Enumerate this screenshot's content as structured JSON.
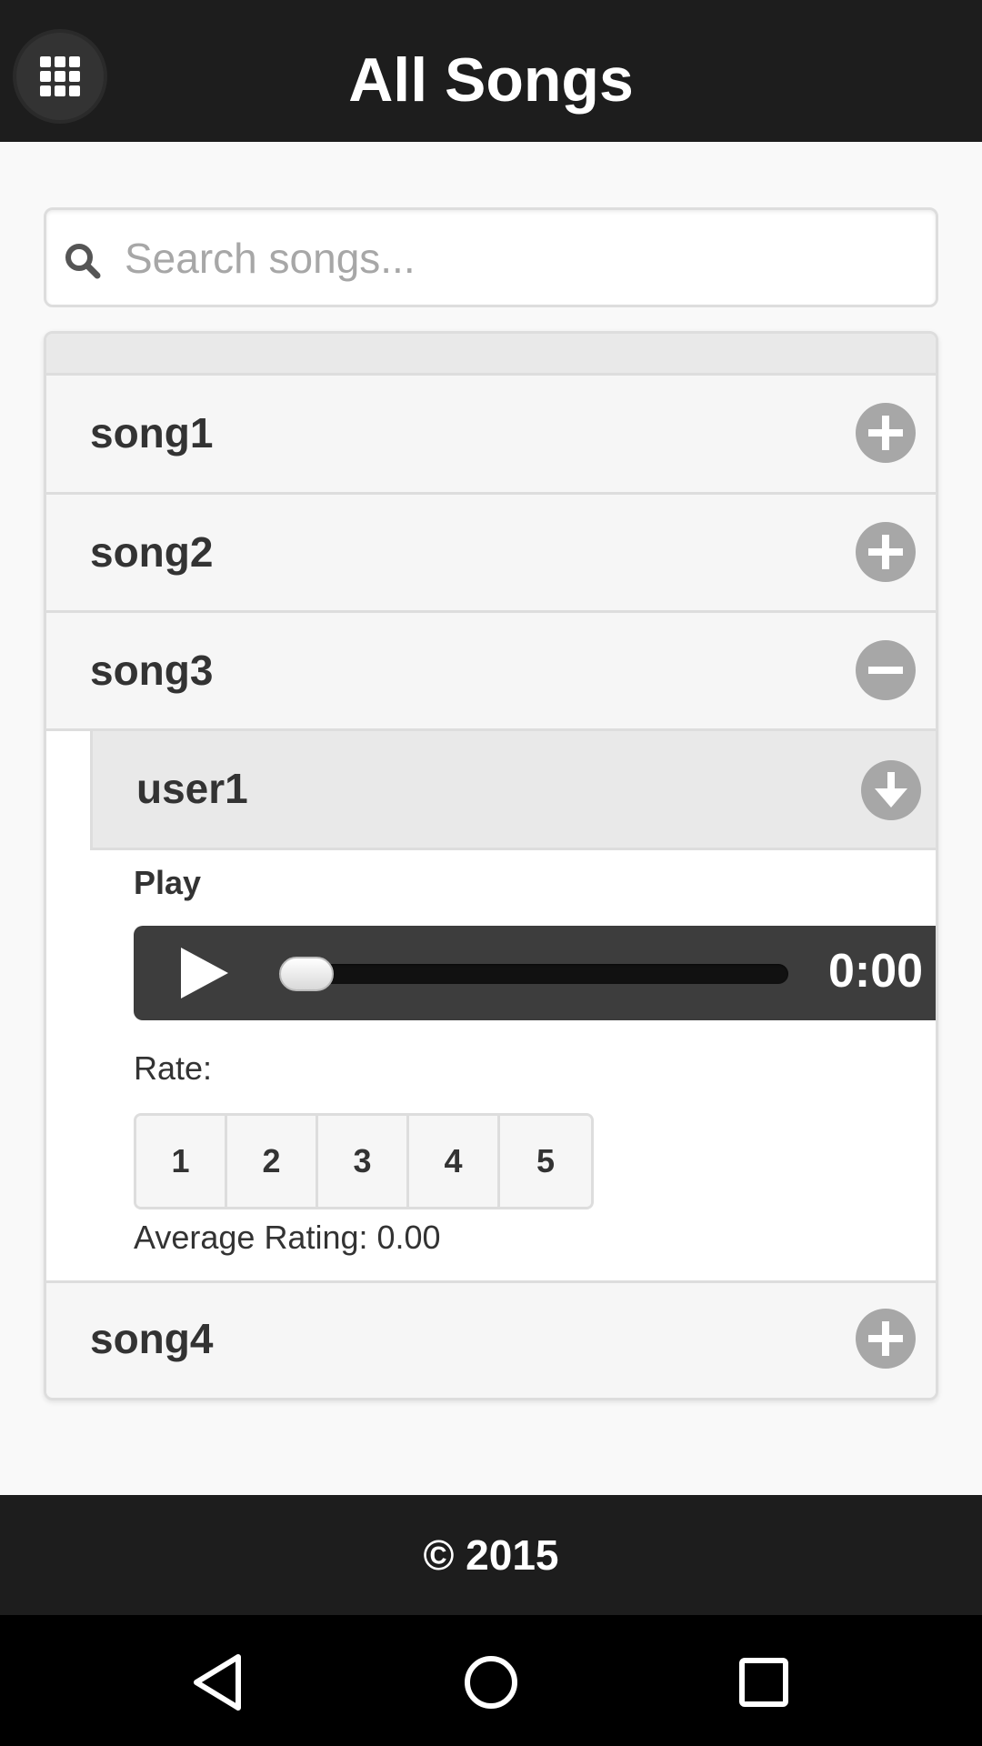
{
  "header": {
    "title": "All Songs",
    "menu_icon": "grid-menu-icon"
  },
  "search": {
    "placeholder": "Search songs...",
    "value": "",
    "icon": "search-icon"
  },
  "songs": [
    {
      "label": "song1",
      "state": "collapsed",
      "icon": "plus-circle-icon"
    },
    {
      "label": "song2",
      "state": "collapsed",
      "icon": "plus-circle-icon"
    },
    {
      "label": "song3",
      "state": "expanded",
      "icon": "minus-circle-icon"
    },
    {
      "label": "song4",
      "state": "collapsed",
      "icon": "plus-circle-icon"
    }
  ],
  "expanded": {
    "user": {
      "label": "user1",
      "icon": "arrow-down-circle-icon"
    },
    "play_label": "Play",
    "player": {
      "time": "0:00",
      "progress": 0.0
    },
    "rate_label": "Rate:",
    "ratings": [
      "1",
      "2",
      "3",
      "4",
      "5"
    ],
    "average": "Average Rating: 0.00"
  },
  "footer": {
    "text": "© 2015"
  },
  "colors": {
    "bar": "#1d1d1d",
    "page": "#f9f9f9",
    "row": "#f6f6f6",
    "border": "#dddddd",
    "icon_circle": "#a7a7a7",
    "player": "#3d3d3d"
  }
}
